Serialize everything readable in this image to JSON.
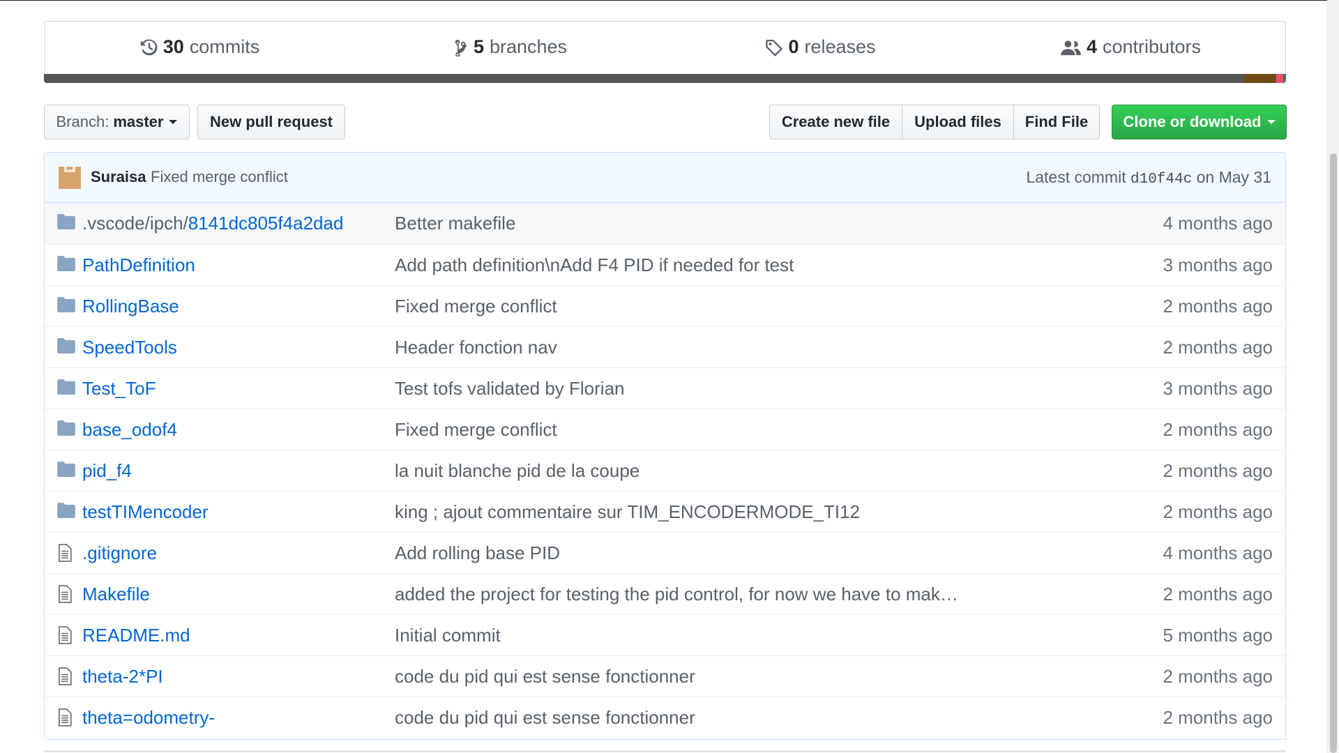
{
  "summary": {
    "commits": {
      "count": "30",
      "label": "commits",
      "icon": "history-icon"
    },
    "branches": {
      "count": "5",
      "label": "branches",
      "icon": "git-branch-icon"
    },
    "releases": {
      "count": "0",
      "label": "releases",
      "icon": "tag-icon"
    },
    "contributors": {
      "count": "4",
      "label": "contributors",
      "icon": "people-icon"
    }
  },
  "language_bar": [
    {
      "color": "#555555",
      "share": 0.966
    },
    {
      "color": "#6e4c13",
      "share": 0.026
    },
    {
      "color": "#f34b7d",
      "share": 0.006
    },
    {
      "color": "#427819",
      "share": 0.001
    },
    {
      "color": "#3572a5",
      "share": 0.001
    }
  ],
  "toolbar": {
    "branch_prefix": "Branch:",
    "branch_name": "master",
    "new_pull_request": "New pull request",
    "create_new_file": "Create new file",
    "upload_files": "Upload files",
    "find_file": "Find File",
    "clone_or_download": "Clone or download"
  },
  "latest_commit": {
    "author": "Suraisa",
    "message": "Fixed merge conflict",
    "prefix": "Latest commit",
    "sha": "d10f44c",
    "date": "on May 31"
  },
  "files": [
    {
      "type": "dir",
      "name_dim": ".vscode/ipch/",
      "name": "8141dc805f4a2dad",
      "message": "Better makefile",
      "age": "4 months ago"
    },
    {
      "type": "dir",
      "name_dim": "",
      "name": "PathDefinition",
      "message": "Add path definition\\nAdd F4 PID if needed for test",
      "age": "3 months ago"
    },
    {
      "type": "dir",
      "name_dim": "",
      "name": "RollingBase",
      "message": "Fixed merge conflict",
      "age": "2 months ago"
    },
    {
      "type": "dir",
      "name_dim": "",
      "name": "SpeedTools",
      "message": "Header fonction nav",
      "age": "2 months ago"
    },
    {
      "type": "dir",
      "name_dim": "",
      "name": "Test_ToF",
      "message": "Test tofs validated by Florian",
      "age": "3 months ago"
    },
    {
      "type": "dir",
      "name_dim": "",
      "name": "base_odof4",
      "message": "Fixed merge conflict",
      "age": "2 months ago"
    },
    {
      "type": "dir",
      "name_dim": "",
      "name": "pid_f4",
      "message": "la nuit blanche pid de la coupe",
      "age": "2 months ago"
    },
    {
      "type": "dir",
      "name_dim": "",
      "name": "testTIMencoder",
      "message": "king ; ajout commentaire sur TIM_ENCODERMODE_TI12",
      "age": "2 months ago"
    },
    {
      "type": "file",
      "name_dim": "",
      "name": ".gitignore",
      "message": "Add rolling base PID",
      "age": "4 months ago"
    },
    {
      "type": "file",
      "name_dim": "",
      "name": "Makefile",
      "message": "added the project for testing the pid control, for now we have to mak…",
      "age": "2 months ago"
    },
    {
      "type": "file",
      "name_dim": "",
      "name": "README.md",
      "message": "Initial commit",
      "age": "5 months ago"
    },
    {
      "type": "file",
      "name_dim": "",
      "name": "theta-2*PI",
      "message": "code du pid qui est sense fonctionner",
      "age": "2 months ago"
    },
    {
      "type": "file",
      "name_dim": "",
      "name": "theta=odometry-",
      "message": "code du pid qui est sense fonctionner",
      "age": "2 months ago"
    }
  ]
}
